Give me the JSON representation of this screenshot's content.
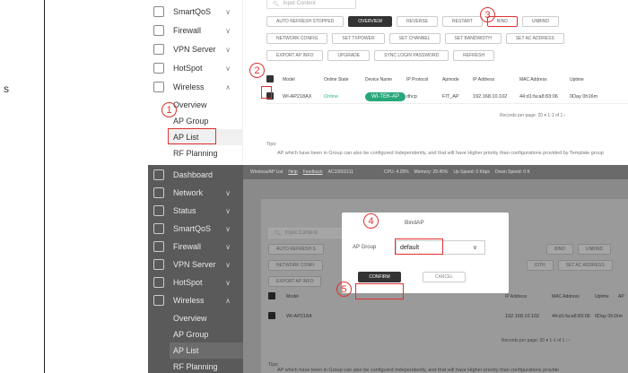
{
  "left_edge": {
    "text": "s"
  },
  "top": {
    "sidebar": {
      "items": [
        {
          "label": "SmartQoS",
          "icon": "qos-icon"
        },
        {
          "label": "Firewall",
          "icon": "shield-icon"
        },
        {
          "label": "VPN Server",
          "icon": "vpn-icon"
        },
        {
          "label": "HotSpot",
          "icon": "hotspot-icon"
        },
        {
          "label": "Wireless",
          "icon": "wifi-icon"
        }
      ],
      "sub": [
        "Overview",
        "AP Group",
        "AP List",
        "RF Planning"
      ]
    },
    "search_placeholder": "Input Content",
    "buttons_row1": [
      "AUTO REFRESH STOPPED",
      "OVERVIEW",
      "REVERSE",
      "RESTART",
      "BIND",
      "UNBIND"
    ],
    "buttons_row2": [
      "NETWORK CONFIG",
      "SET TXPOWER",
      "SET CHANNEL",
      "SET BANDWIDTH",
      "SET AC ADDRESS"
    ],
    "buttons_row3": [
      "EXPORT AP INFO",
      "UPGRADE",
      "SYNC LOGIN PASSWORD",
      "REFRESH"
    ],
    "columns": [
      "Model",
      "Online State",
      "Device Name",
      "IP Protocol",
      "Apmode",
      "IP Address",
      "MAC Address",
      "Uptime"
    ],
    "row": {
      "model": "WI-AP218AX",
      "state": "Online",
      "device": "WI-TEK-AP",
      "protocol": "dhcp",
      "apmode": "FIT_AP",
      "ip": "192.168.10.102",
      "mac": "44:d1:fa:a8:83:06",
      "uptime": "0Day 0h16m"
    },
    "records": "Records per page:  20  ▾   1-1 of 1   ‹",
    "tips_title": "Tips:",
    "tips_text": "AP which have been in Group can also be configured Independently, and that will have Higher priority than configurations provided by Template group"
  },
  "callouts": [
    "1",
    "2",
    "3",
    "4",
    "5"
  ],
  "bottom": {
    "sidebar": {
      "items": [
        {
          "label": "Dashboard",
          "icon": "dashboard-icon"
        },
        {
          "label": "Network",
          "icon": "network-icon"
        },
        {
          "label": "Status",
          "icon": "status-icon"
        },
        {
          "label": "SmartQoS",
          "icon": "qos-icon"
        },
        {
          "label": "Firewall",
          "icon": "shield-icon"
        },
        {
          "label": "VPN Server",
          "icon": "vpn-icon"
        },
        {
          "label": "HotSpot",
          "icon": "hotspot-icon"
        },
        {
          "label": "Wireless",
          "icon": "wifi-icon"
        }
      ],
      "sub": [
        "Overview",
        "AP Group",
        "AP List",
        "RF Planning"
      ]
    },
    "header": {
      "breadcrumb": "Wireless/AP List",
      "help": "Help",
      "feedback": "Feedback",
      "id": "AC10002111",
      "cpu": "CPU: 4.28%",
      "memory": "Memory: 29.45%",
      "up": "Up Speed: 0 Kbps",
      "down": "Down Speed: 0 K"
    },
    "search_placeholder": "Input Content",
    "buttons_row1": [
      "AUTO REFRESH S",
      "BIND",
      "UNBIND"
    ],
    "buttons_row2": [
      "NETWORK CONFI",
      "IDTH",
      "SET AC ADDRESS"
    ],
    "buttons_row3": [
      "EXPORT AP INFO"
    ],
    "columns": [
      "Model",
      "IP Address",
      "MAC Address",
      "Uptime",
      "AP"
    ],
    "row": {
      "model": "WI-AP218A",
      "ip": "192.168.10.102",
      "mac": "44:d1:fa:a8:83:06",
      "uptime": "0Day 0h16m"
    },
    "records": "Records per page:  20  ▾   1-1 of 1   ‹   ›",
    "tips_title": "Tips:",
    "tips_text": "AP which have been in Group can also be configured Independently, and that will have Higher priority than configurations provide",
    "modal": {
      "title": "BindAP",
      "label": "AP Group",
      "value": "default",
      "confirm": "CONFIRM",
      "cancel": "CANCEL"
    }
  }
}
